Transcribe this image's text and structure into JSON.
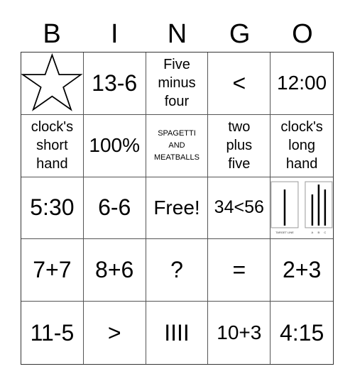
{
  "header": {
    "letters": [
      "B",
      "I",
      "N",
      "G",
      "O"
    ]
  },
  "cells": [
    [
      {
        "type": "icon",
        "icon": "star-icon"
      },
      {
        "type": "text",
        "text": "13-6",
        "size": "xl"
      },
      {
        "type": "lines",
        "lines": [
          "Five",
          "minus",
          "four"
        ]
      },
      {
        "type": "text",
        "text": "<",
        "size": "xl"
      },
      {
        "type": "text",
        "text": "12:00",
        "size": "lg"
      }
    ],
    [
      {
        "type": "lines",
        "lines": [
          "clock's",
          "short",
          "hand"
        ]
      },
      {
        "type": "text",
        "text": "100%",
        "size": "lg"
      },
      {
        "type": "small",
        "lines": [
          "SPAGETTI",
          "AND",
          "MEATBALLS"
        ]
      },
      {
        "type": "lines",
        "lines": [
          "two",
          "plus",
          "five"
        ]
      },
      {
        "type": "lines",
        "lines": [
          "clock's",
          "long",
          "hand"
        ]
      }
    ],
    [
      {
        "type": "text",
        "text": "5:30",
        "size": "xl"
      },
      {
        "type": "text",
        "text": "6-6",
        "size": "xl"
      },
      {
        "type": "text",
        "text": "Free!",
        "size": "lg"
      },
      {
        "type": "text",
        "text": "34<56",
        "size": "md"
      },
      {
        "type": "icon",
        "icon": "asch-lines-image",
        "target_label": "TARGET LINE",
        "choice_labels": [
          "A",
          "B",
          "C"
        ]
      }
    ],
    [
      {
        "type": "text",
        "text": "7+7",
        "size": "xl"
      },
      {
        "type": "text",
        "text": "8+6",
        "size": "xl"
      },
      {
        "type": "text",
        "text": "?",
        "size": "xl"
      },
      {
        "type": "text",
        "text": "=",
        "size": "xl"
      },
      {
        "type": "text",
        "text": "2+3",
        "size": "xl"
      }
    ],
    [
      {
        "type": "text",
        "text": "11-5",
        "size": "xl"
      },
      {
        "type": "text",
        "text": ">",
        "size": "xl"
      },
      {
        "type": "text",
        "text": "IIII",
        "size": "xl"
      },
      {
        "type": "text",
        "text": "10+3",
        "size": "lg"
      },
      {
        "type": "text",
        "text": "4:15",
        "size": "xl"
      }
    ]
  ]
}
